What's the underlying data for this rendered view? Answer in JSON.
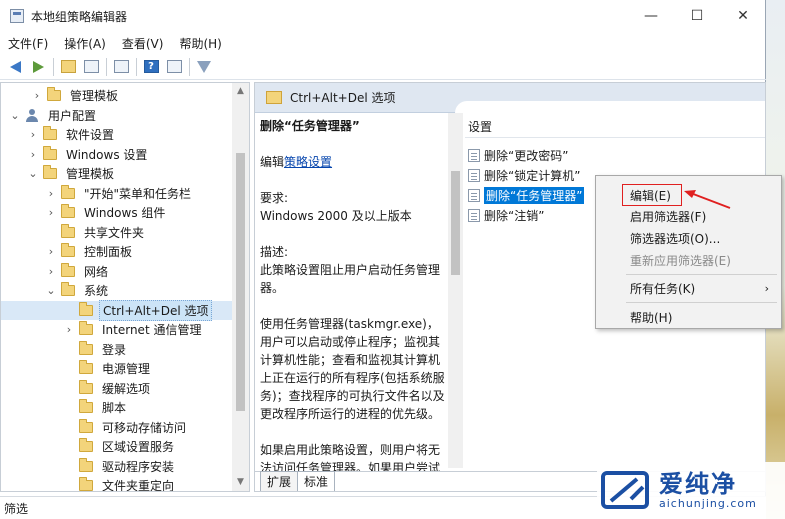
{
  "window": {
    "title": "本地组策略编辑器",
    "minimize": "—",
    "maximize": "☐",
    "close": "✕"
  },
  "menu": {
    "file": "文件(F)",
    "action": "操作(A)",
    "view": "查看(V)",
    "help": "帮助(H)"
  },
  "tree": {
    "items": [
      {
        "label": "管理模板",
        "expander": "›",
        "icon": "folder"
      },
      {
        "label": "用户配置",
        "expander": "⌄",
        "icon": "user"
      },
      {
        "label": "软件设置",
        "expander": "›",
        "icon": "folder"
      },
      {
        "label": "Windows 设置",
        "expander": "›",
        "icon": "folder"
      },
      {
        "label": "管理模板",
        "expander": "⌄",
        "icon": "folder"
      },
      {
        "label": "\"开始\"菜单和任务栏",
        "expander": "›",
        "icon": "folder"
      },
      {
        "label": "Windows 组件",
        "expander": "›",
        "icon": "folder"
      },
      {
        "label": "共享文件夹",
        "expander": "",
        "icon": "folder"
      },
      {
        "label": "控制面板",
        "expander": "›",
        "icon": "folder"
      },
      {
        "label": "网络",
        "expander": "›",
        "icon": "folder"
      },
      {
        "label": "系统",
        "expander": "⌄",
        "icon": "folder"
      },
      {
        "label": "Ctrl+Alt+Del 选项",
        "expander": "",
        "icon": "folder",
        "selected": true
      },
      {
        "label": "Internet 通信管理",
        "expander": "›",
        "icon": "folder"
      },
      {
        "label": "登录",
        "expander": "",
        "icon": "folder"
      },
      {
        "label": "电源管理",
        "expander": "",
        "icon": "folder"
      },
      {
        "label": "缓解选项",
        "expander": "",
        "icon": "folder"
      },
      {
        "label": "脚本",
        "expander": "",
        "icon": "folder"
      },
      {
        "label": "可移动存储访问",
        "expander": "",
        "icon": "folder"
      },
      {
        "label": "区域设置服务",
        "expander": "",
        "icon": "folder"
      },
      {
        "label": "驱动程序安装",
        "expander": "",
        "icon": "folder"
      },
      {
        "label": "文件夹重定向",
        "expander": "",
        "icon": "folder"
      }
    ]
  },
  "right": {
    "header": "Ctrl+Alt+Del 选项",
    "desc": {
      "title": "删除“任务管理器”",
      "edit_prefix": "编辑",
      "edit_link": "策略设置",
      "req_label": "要求:",
      "req_value": "Windows 2000 及以上版本",
      "desc_label": "描述:",
      "desc_value": "此策略设置阻止用户启动任务管理器。",
      "p1": "使用任务管理器(taskmgr.exe)，用户可以启动或停止程序；监视其计算机性能；查看和监视其计算机上正在运行的所有程序(包括系统服务)；查找程序的可执行文件名以及更改程序所运行的进程的优先级。",
      "p2": "如果启用此策略设置，则用户将无法访问任务管理器。如果用户尝试启动任务管理器，则将显示一条消息，说明已禁用此策略。"
    },
    "settings_header": "设置",
    "settings": [
      "删除“更改密码”",
      "删除“锁定计算机”",
      "删除“任务管理器”",
      "删除“注销”"
    ],
    "tabs": {
      "extended": "扩展",
      "standard": "标准"
    }
  },
  "context_menu": {
    "edit": "编辑(E)",
    "enable_filter": "启用筛选器(F)",
    "filter_options": "筛选器选项(O)...",
    "reapply_filter": "重新应用筛选器(E)",
    "all_tasks": "所有任务(K)",
    "help": "帮助(H)"
  },
  "status": {
    "text": "筛选"
  },
  "watermark": {
    "big": "爱纯净",
    "small": "aichunjing.com"
  },
  "colors": {
    "selection": "#0078d7",
    "highlight_box": "#e02020",
    "watermark": "#1b4fa3"
  }
}
